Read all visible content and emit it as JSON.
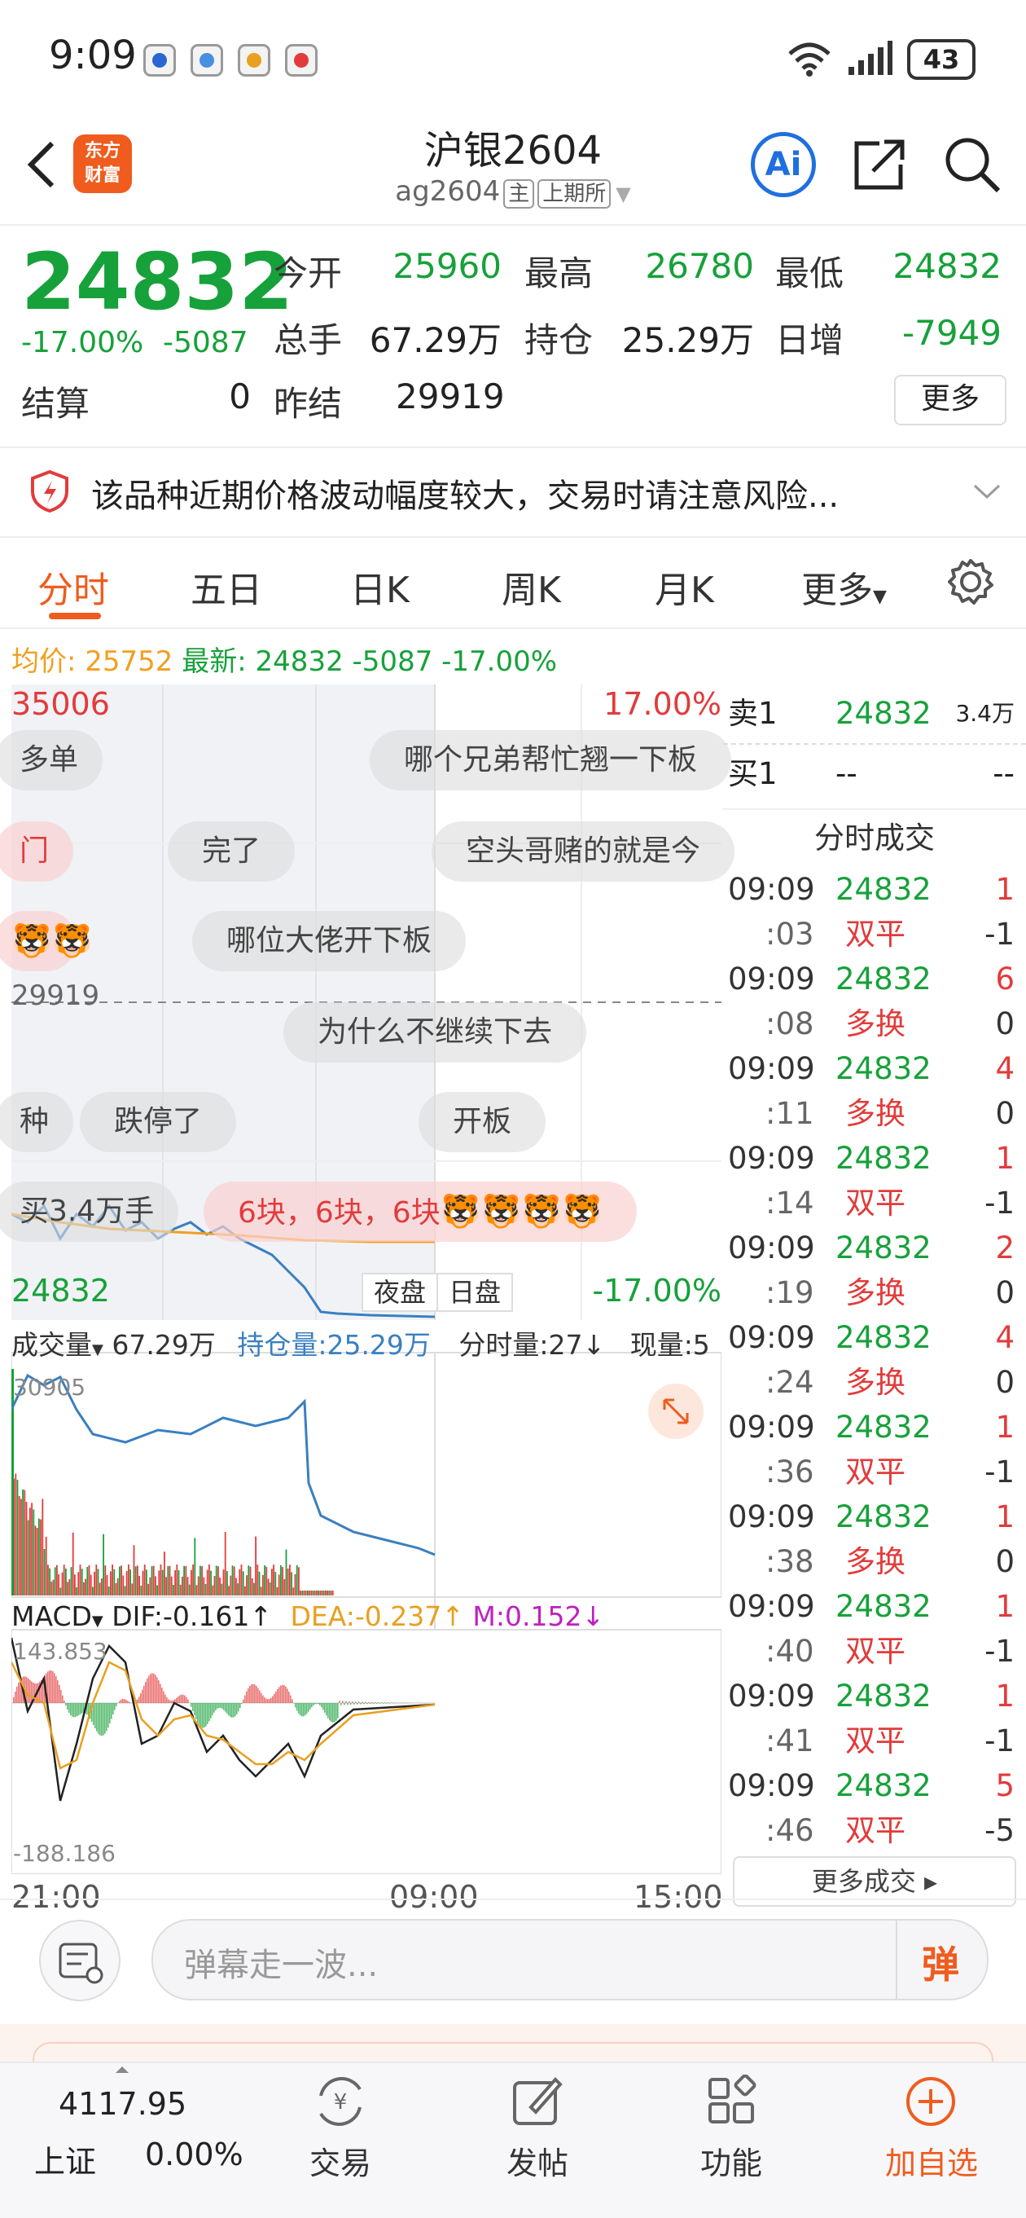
{
  "status": {
    "time": "9:09",
    "battery": "43"
  },
  "nav": {
    "logo": "东方\n财富",
    "title": "沪银2604",
    "code": "ag2604",
    "tag_main": "主",
    "tag_exchange": "上期所",
    "ai_label": "Ai"
  },
  "quote": {
    "price": "24832",
    "pct": "-17.00%",
    "change": "-5087",
    "open_label": "今开",
    "open": "25960",
    "high_label": "最高",
    "high": "26780",
    "low_label": "最低",
    "low": "24832",
    "volume_label": "总手",
    "volume": "67.29万",
    "oi_label": "持仓",
    "oi": "25.29万",
    "daily_label": "日增",
    "daily": "-7949",
    "settle_label": "结算",
    "settle": "0",
    "prev_settle_label": "昨结",
    "prev_settle": "29919",
    "more": "更多"
  },
  "risk": {
    "text": "该品种近期价格波动幅度较大，交易时请注意风险..."
  },
  "tabs": [
    "分时",
    "五日",
    "日K",
    "周K",
    "月K",
    "更多"
  ],
  "avg": {
    "avg_label": "均价:",
    "avg": "25752",
    "latest_label": "最新:",
    "latest": "24832",
    "chg": "-5087",
    "pct": "-17.00%"
  },
  "chart": {
    "top_price": "35006",
    "top_pct": "17.00%",
    "mid_price": "29919",
    "bot_price": "24832",
    "bot_pct": "-17.00%",
    "night_label": "夜盘",
    "day_label": "日盘",
    "vol_label": "成交量",
    "vol_val": "67.29万",
    "oi_label": "持仓量:25.29万",
    "tick_label": "分时量:27↓",
    "now_label": "现量:5",
    "vol_max": "30905",
    "macd_label": "MACD",
    "dif": "DIF:-0.161↑",
    "dea": "DEA:-0.237↑",
    "m": "M:0.152↓",
    "macd_max": "143.853",
    "macd_min": "-188.186",
    "x_labels": [
      "21:00",
      "09:00",
      "15:00"
    ],
    "colors": {
      "up": "#e23b3b",
      "down": "#17a13a",
      "avg": "#f0a020",
      "price": "#3a7fc0",
      "dea": "#e8a020",
      "m": "#c020c0"
    }
  },
  "danmu": [
    "多单",
    "哪个兄弟帮忙翘一下板",
    "门",
    "完了",
    "空头哥赌的就是今",
    "哪位大佬开下板",
    "为什么不继续下去",
    "种",
    "跌停了",
    "开板",
    "买3.4万手",
    "6块，6块，6块"
  ],
  "book": {
    "sell_label": "卖1",
    "sell_price": "24832",
    "sell_vol": "3.4万",
    "buy_label": "买1",
    "buy_price": "--",
    "buy_vol": "--",
    "trades_title": "分时成交",
    "trades": [
      {
        "t": "09:09",
        "p": "24832",
        "v": "1",
        "s": ":03",
        "type": "双平",
        "d": "-1"
      },
      {
        "t": "09:09",
        "p": "24832",
        "v": "6",
        "s": ":08",
        "type": "多换",
        "d": "0"
      },
      {
        "t": "09:09",
        "p": "24832",
        "v": "4",
        "s": ":11",
        "type": "多换",
        "d": "0"
      },
      {
        "t": "09:09",
        "p": "24832",
        "v": "1",
        "s": ":14",
        "type": "双平",
        "d": "-1"
      },
      {
        "t": "09:09",
        "p": "24832",
        "v": "2",
        "s": ":19",
        "type": "多换",
        "d": "0"
      },
      {
        "t": "09:09",
        "p": "24832",
        "v": "4",
        "s": ":24",
        "type": "多换",
        "d": "0"
      },
      {
        "t": "09:09",
        "p": "24832",
        "v": "1",
        "s": ":36",
        "type": "双平",
        "d": "-1"
      },
      {
        "t": "09:09",
        "p": "24832",
        "v": "1",
        "s": ":38",
        "type": "多换",
        "d": "0"
      },
      {
        "t": "09:09",
        "p": "24832",
        "v": "1",
        "s": ":40",
        "type": "双平",
        "d": "-1"
      },
      {
        "t": "09:09",
        "p": "24832",
        "v": "1",
        "s": ":41",
        "type": "双平",
        "d": "-1"
      },
      {
        "t": "09:09",
        "p": "24832",
        "v": "5",
        "s": ":46",
        "type": "双平",
        "d": "-5"
      }
    ],
    "more_trades": "更多成交 ▸"
  },
  "input": {
    "placeholder": "弹幕走一波...",
    "send": "弹"
  },
  "bottom": {
    "index_value": "4117.95",
    "index_name": "上证",
    "index_pct": "0.00%",
    "items": [
      "交易",
      "发帖",
      "功能",
      "加自选"
    ]
  }
}
